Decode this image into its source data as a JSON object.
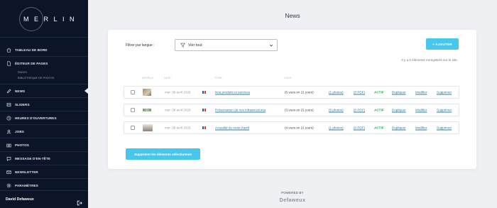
{
  "brand": {
    "logo_text": "MERLIN"
  },
  "sidebar": {
    "items": [
      {
        "label": "TABLEAU DE BORD",
        "icon": "home-icon"
      },
      {
        "label": "ÉDITEUR DE PAGES",
        "icon": "page-icon"
      },
      {
        "label": "NEWS",
        "icon": "pencil-icon"
      },
      {
        "label": "SLIDERS",
        "icon": "slider-icon"
      },
      {
        "label": "HEURES D'OUVERTURES",
        "icon": "clock-icon"
      },
      {
        "label": "JOBS",
        "icon": "user-icon"
      },
      {
        "label": "PHOTOS",
        "icon": "camera-icon"
      },
      {
        "label": "MESSAGE D'EN-TÊTE",
        "icon": "message-icon"
      },
      {
        "label": "NEWSLETTER",
        "icon": "mail-icon"
      },
      {
        "label": "PARAMÈTRES",
        "icon": "gear-icon"
      }
    ],
    "sub_items": [
      "PAGES",
      "BIBLIOTHÈQUE DE PHOTOS"
    ],
    "user_name": "David Defaweux"
  },
  "page": {
    "title": "News"
  },
  "filter": {
    "label": "Filtrer par langue :",
    "value": "Voir tout"
  },
  "add_button": "+ AJOUTER",
  "count_text": "Il y a 3 éléments enregistrés sur le site.",
  "columns": {
    "preview": "APERÇU",
    "date": "DATE",
    "title": "TITRE",
    "views": "VUES"
  },
  "rows": [
    {
      "date": "mer. 08 avril 2026",
      "title": "Nos produits et services",
      "views": "(5 vues en 21 jours)",
      "photos": "(1 photos)",
      "pdf": "(0 PDF)",
      "status": "ACTIF",
      "duplicate": "Dupliquer",
      "edit": "Modifier",
      "delete": "Supprimer"
    },
    {
      "date": "mer. 08 avril 2026",
      "title": "Présentation de nos infrastructures",
      "views": "(3 vues en 21 jours)",
      "photos": "(5 photos)",
      "pdf": "(0 PDF)",
      "status": "ACTIF",
      "duplicate": "Dupliquer",
      "edit": "Modifier",
      "delete": "Supprimer"
    },
    {
      "date": "mer. 08 avril 2026",
      "title": "Actualité du mois d'avril",
      "views": "(4 vues en 21 jours)",
      "photos": "(1 photos)",
      "pdf": "(0 PDF)",
      "status": "ACTIF",
      "duplicate": "Dupliquer",
      "edit": "Modifier",
      "delete": "Supprimer"
    }
  ],
  "bulk_delete_button": "Supprimer les éléments sélectionnés",
  "footer": {
    "powered_by": "POWERED BY",
    "brand": "Defaweux"
  },
  "colors": {
    "sidebar_bg": "#0c1527",
    "accent": "#48c7ec",
    "link": "#2c7da0",
    "status_active": "#1aa548"
  }
}
